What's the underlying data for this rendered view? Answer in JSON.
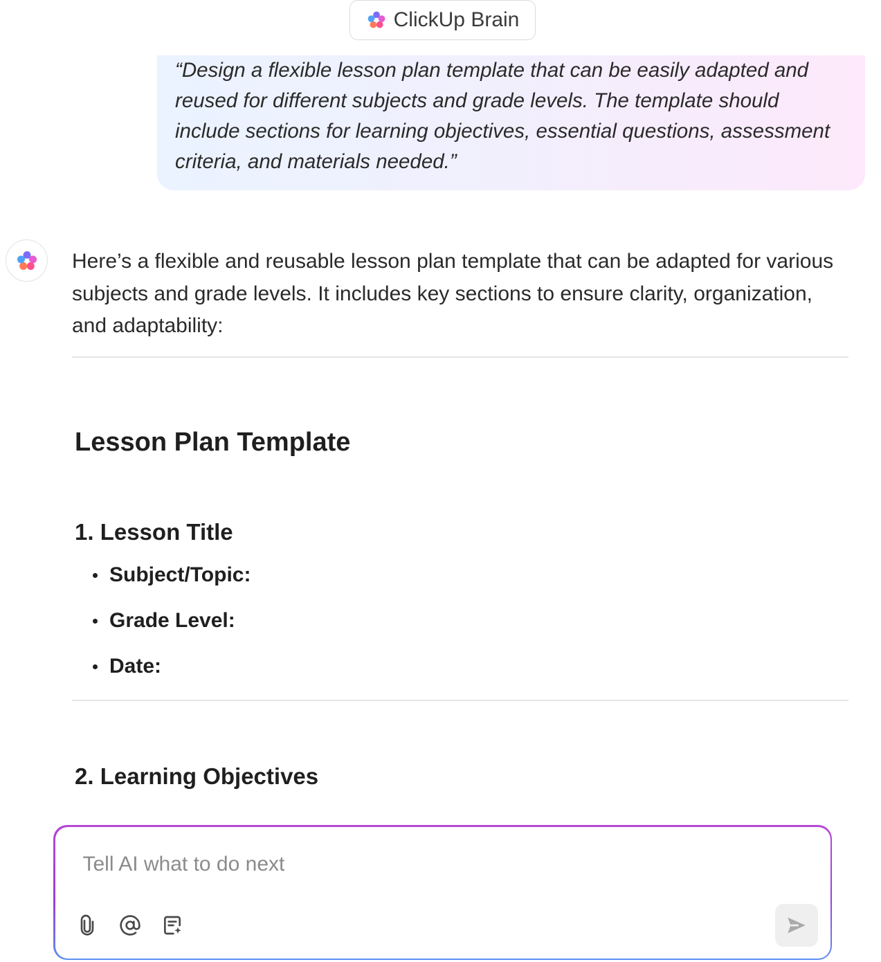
{
  "header": {
    "title": "ClickUp Brain",
    "logo_icon": "clickup-brain-logo-icon"
  },
  "prompt": {
    "text": "“Design a flexible lesson plan template that can be easily adapted and reused for different subjects and grade levels. The template should include sections for learning objectives, essential questions, assessment criteria, and materials needed.”"
  },
  "response": {
    "avatar_icon": "clickup-brain-logo-icon",
    "intro": "Here’s a flexible and reusable lesson plan template that can be adapted for various subjects and grade levels. It includes key sections to ensure clarity, organization, and adaptability:",
    "heading": "Lesson Plan Template",
    "sections": [
      {
        "title": "1. Lesson Title",
        "bullets": [
          "Subject/Topic:",
          "Grade Level:",
          "Date:"
        ]
      },
      {
        "title": "2. Learning Objectives"
      }
    ]
  },
  "input": {
    "placeholder": "Tell AI what to do next",
    "value": "",
    "tools": [
      "attach-icon",
      "mention-icon",
      "ai-doc-icon"
    ],
    "send_icon": "send-icon"
  },
  "colors": {
    "input_border_top": "#b548d4",
    "input_border_bottom": "#5d8ff0",
    "bubble_left": "#eaf3ff",
    "bubble_right": "#fde9fb"
  }
}
